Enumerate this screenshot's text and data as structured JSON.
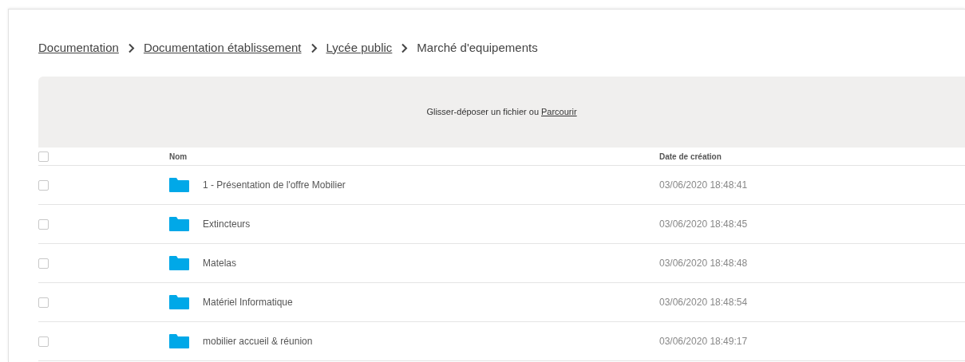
{
  "breadcrumb": [
    {
      "label": "Documentation",
      "link": true
    },
    {
      "label": "Documentation établissement",
      "link": true
    },
    {
      "label": "Lycée public",
      "link": true
    },
    {
      "label": "Marché d'equipements",
      "link": false
    }
  ],
  "dropzone": {
    "text": "Glisser-déposer un fichier ou",
    "link": "Parcourir"
  },
  "table": {
    "select_all": {
      "checked": false
    },
    "columns": [
      "Nom",
      "Date de création"
    ],
    "rows": [
      {
        "name": "1 - Présentation de l'offre Mobilier",
        "date": "03/06/2020 18:48:41",
        "checked": false
      },
      {
        "name": "Extincteurs",
        "date": "03/06/2020 18:48:45",
        "checked": false
      },
      {
        "name": "Matelas",
        "date": "03/06/2020 18:48:48",
        "checked": false
      },
      {
        "name": "Matériel Informatique",
        "date": "03/06/2020 18:48:54",
        "checked": false
      },
      {
        "name": "mobilier accueil & réunion",
        "date": "03/06/2020 18:49:17",
        "checked": false
      }
    ]
  }
}
